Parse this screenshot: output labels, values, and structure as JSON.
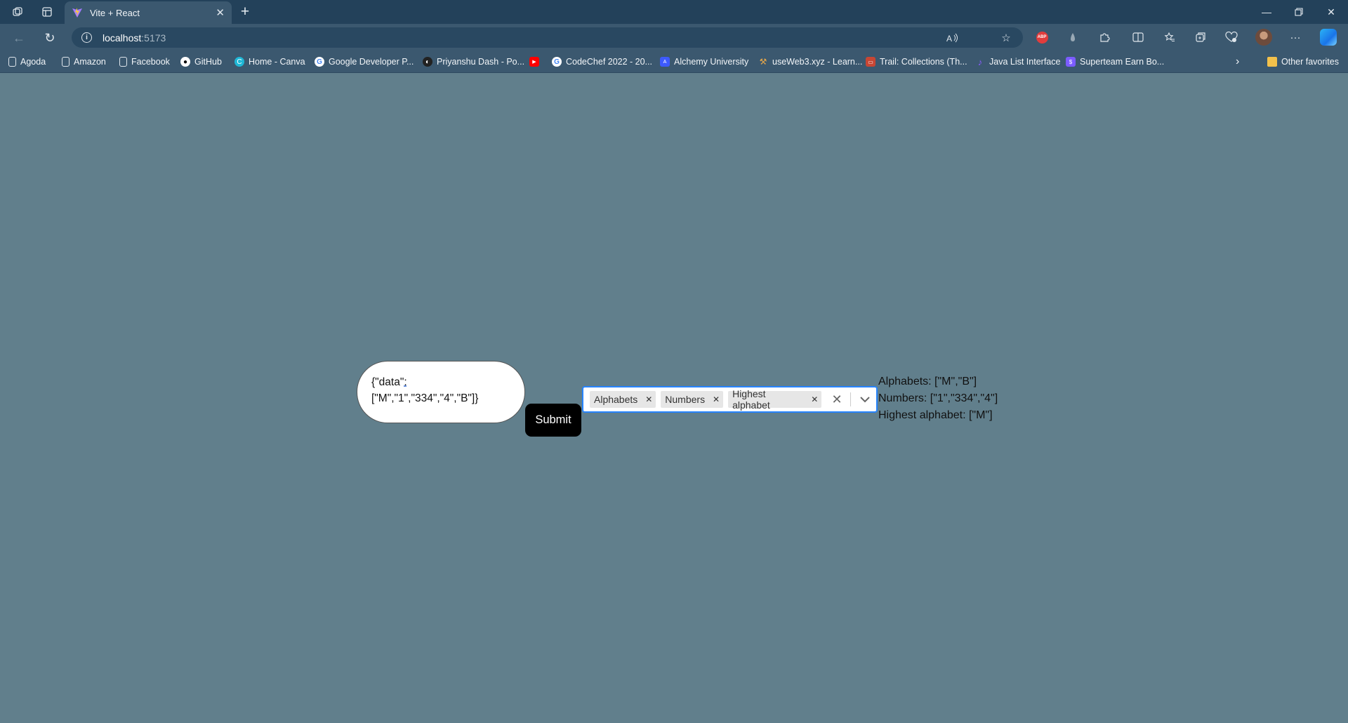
{
  "browser": {
    "tab_title": "Vite + React",
    "url_host": "localhost",
    "url_port": ":5173",
    "bookmarks": [
      {
        "label": "Agoda",
        "icon": "page-icon"
      },
      {
        "label": "Amazon",
        "icon": "page-icon"
      },
      {
        "label": "Facebook",
        "icon": "page-icon"
      },
      {
        "label": "GitHub",
        "icon": "github-icon"
      },
      {
        "label": "Home - Canva",
        "icon": "canva-icon"
      },
      {
        "label": "Google Developer P...",
        "icon": "google-icon"
      },
      {
        "label": "Priyanshu Dash - Po...",
        "icon": "portfolio-icon"
      },
      {
        "label": "",
        "icon": "youtube-icon"
      },
      {
        "label": "CodeChef 2022 - 20...",
        "icon": "google-icon"
      },
      {
        "label": "Alchemy University",
        "icon": "alchemy-icon"
      },
      {
        "label": "useWeb3.xyz - Learn...",
        "icon": "tools-icon"
      },
      {
        "label": "Trail: Collections (Th...",
        "icon": "oracle-icon"
      },
      {
        "label": "Java List Interface",
        "icon": "java-icon"
      },
      {
        "label": "Superteam Earn Bo...",
        "icon": "superteam-icon"
      }
    ],
    "other_favorites": "Other favorites"
  },
  "app": {
    "json_input": {
      "line1_pre": "{\"data\"",
      "line1_mark": ": ",
      "line2": "[\"M\",\"1\",\"334\",\"4\",\"B\"]}"
    },
    "submit_label": "Submit",
    "selected_filters": [
      "Alphabets",
      "Numbers",
      "Highest alphabet"
    ],
    "results": {
      "alphabets": "Alphabets: [\"M\",\"B\"]",
      "numbers": "Numbers: [\"1\",\"334\",\"4\"]",
      "highest_alphabet": "Highest alphabet: [\"M\"]"
    }
  },
  "colors": {
    "page_bg": "#617f8c",
    "chrome_bg": "#3b586f",
    "select_focus_border": "#2684ff",
    "submit_bg": "#000000"
  }
}
